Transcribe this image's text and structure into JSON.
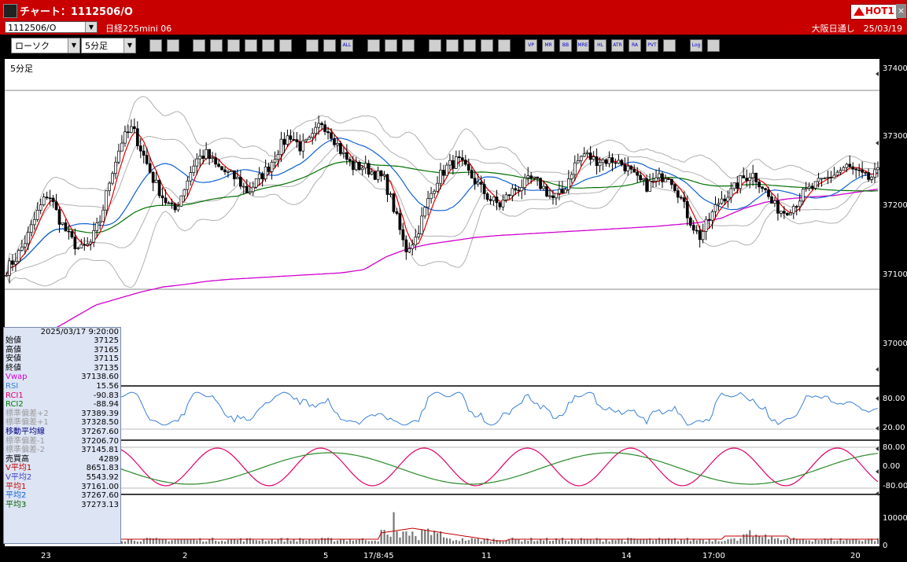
{
  "window": {
    "title": "チャート：1112506/O",
    "hot_label": "HOT1",
    "close_label": "×"
  },
  "symbol_bar": {
    "symbol": "1112506/O",
    "instrument": "日経225mini 06",
    "right_info": "大阪日通し　25/03/19"
  },
  "toolbar": {
    "chart_type": "ローソク",
    "interval": "5分足",
    "buttons": [
      "zoom-in",
      "crosshair",
      "draw-line",
      "fib",
      "cursor",
      "rewind",
      "list",
      "trash",
      "bar-width",
      "bar-narrow",
      "all",
      "settings",
      "pencil",
      "palette",
      "print",
      "search",
      "table",
      "delete",
      "info",
      "vp",
      "mr",
      "bb",
      "mre",
      "hl",
      "atr",
      "ra",
      "pvt",
      "box",
      "log",
      "export"
    ],
    "text_buttons": {
      "all": "ALL",
      "vp": "VP",
      "mr": "MR",
      "bb": "BB",
      "mre": "MRE",
      "hl": "HL",
      "atr": "ATR",
      "ra": "RA",
      "pvt": "PVT",
      "log": "Log"
    }
  },
  "panel_label": "5分足",
  "info": {
    "datetime": "2025/03/17 9:20:00",
    "rows": [
      {
        "label": "始値",
        "value": "37125",
        "color": "#000000"
      },
      {
        "label": "高値",
        "value": "37165",
        "color": "#000000"
      },
      {
        "label": "安値",
        "value": "37115",
        "color": "#000000"
      },
      {
        "label": "終値",
        "value": "37135",
        "color": "#000000"
      },
      {
        "label": "Vwap",
        "value": "37138.60",
        "color": "#d000d0"
      },
      {
        "label": "RSI",
        "value": "15.56",
        "color": "#3a7fd5"
      },
      {
        "label": "RCI1",
        "value": "-90.83",
        "color": "#e0006a"
      },
      {
        "label": "RCI2",
        "value": "-88.94",
        "color": "#007a00"
      },
      {
        "label": "標準偏差+2",
        "value": "37389.39",
        "color": "#9a9a9a"
      },
      {
        "label": "標準偏差+1",
        "value": "37328.50",
        "color": "#9a9a9a"
      },
      {
        "label": "移動平均線",
        "value": "37267.60",
        "color": "#000080"
      },
      {
        "label": "標準偏差-1",
        "value": "37206.70",
        "color": "#9a9a9a"
      },
      {
        "label": "標準偏差-2",
        "value": "37145.81",
        "color": "#9a9a9a"
      },
      {
        "label": "売買高",
        "value": "4289",
        "color": "#000000"
      },
      {
        "label": "V平均1",
        "value": "8651.83",
        "color": "#c00000"
      },
      {
        "label": "V平均2",
        "value": "5543.92",
        "color": "#4040c0"
      },
      {
        "label": "平均1",
        "value": "37161.00",
        "color": "#c00000"
      },
      {
        "label": "平均2",
        "value": "37267.60",
        "color": "#1060d0"
      },
      {
        "label": "平均3",
        "value": "37273.13",
        "color": "#006000"
      }
    ]
  },
  "axes": {
    "price_ticks": [
      "37400",
      "37300",
      "37200",
      "37100",
      "37000"
    ],
    "rsi_ticks": [
      "80.00",
      "20.00"
    ],
    "rci_ticks": [
      "80.00",
      "0.00",
      "-80.00"
    ],
    "volume_ticks": [
      "10000",
      "0"
    ],
    "x_labels": [
      "23",
      "2",
      "5",
      "17/8:45",
      "11",
      "14",
      "17:00",
      "20"
    ]
  },
  "colors": {
    "candle_up": "#ffffff",
    "candle_down": "#000000",
    "ma_fast": "#e00000",
    "ma_mid": "#1060d0",
    "ma_slow": "#007000",
    "vwap": "#d000d0",
    "band": "#b0b0b0",
    "rsi": "#3a7fd5",
    "rci1": "#e0006a",
    "rci2": "#2a8a2a",
    "titlebar": "#c80000"
  },
  "chart_data": {
    "type": "candlestick",
    "ylim": [
      36960,
      37430
    ],
    "price_series_approx": [
      37115,
      37135,
      37165,
      37205,
      37235,
      37195,
      37165,
      37145,
      37155,
      37195,
      37265,
      37315,
      37335,
      37295,
      37255,
      37225,
      37205,
      37245,
      37285,
      37295,
      37275,
      37265,
      37255,
      37235,
      37255,
      37275,
      37305,
      37325,
      37305,
      37315,
      37345,
      37325,
      37295,
      37275,
      37275,
      37265,
      37255,
      37205,
      37145,
      37165,
      37215,
      37255,
      37275,
      37285,
      37265,
      37245,
      37225,
      37215,
      37235,
      37245,
      37255,
      37245,
      37225,
      37235,
      37275,
      37295,
      37285,
      37285,
      37285,
      37275,
      37255,
      37245,
      37255,
      37265,
      37235,
      37195,
      37165,
      37195,
      37225,
      37235,
      37255,
      37265,
      37245,
      37215,
      37205,
      37215,
      37235,
      37245,
      37255,
      37265,
      37275,
      37265,
      37255,
      37265
    ],
    "vwap_approx": [
      36960,
      36990,
      37020,
      37040,
      37060,
      37070,
      37080,
      37088,
      37092,
      37097,
      37100,
      37102,
      37104,
      37106,
      37108,
      37110,
      37115,
      37135,
      37148,
      37155,
      37160,
      37165,
      37168,
      37170,
      37172,
      37174,
      37176,
      37178,
      37180,
      37182,
      37185,
      37188,
      37195,
      37210,
      37220,
      37225,
      37228,
      37230,
      37235,
      37240
    ]
  }
}
